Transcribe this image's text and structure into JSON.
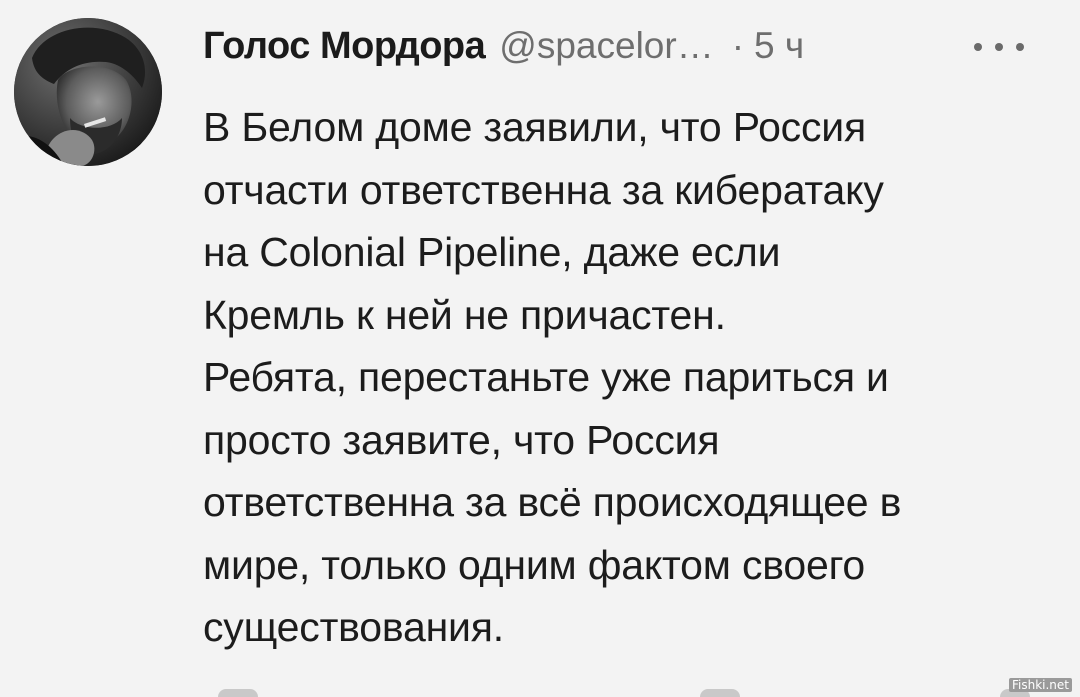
{
  "tweet": {
    "author": {
      "display_name": "Голос Мордора",
      "handle": "@spacelor…",
      "separator": "·",
      "time": "5 ч"
    },
    "more_icon": "more-horizontal-icon",
    "text_lines": [
      "В Белом доме заявили, что Россия",
      "отчасти ответственна за кибератаку",
      "на Colonial Pipeline, даже если",
      "Кремль к ней не причастен.",
      "Ребята, перестаньте уже париться и",
      "просто заявите, что Россия",
      "ответственна за всё происходящее в",
      "мире, только одним фактом своего",
      "существования."
    ]
  },
  "watermark": "Fishki.net",
  "colors": {
    "background": "#f3f3f3",
    "text": "#1c1c1c",
    "secondary_text": "#6e6e6e"
  }
}
